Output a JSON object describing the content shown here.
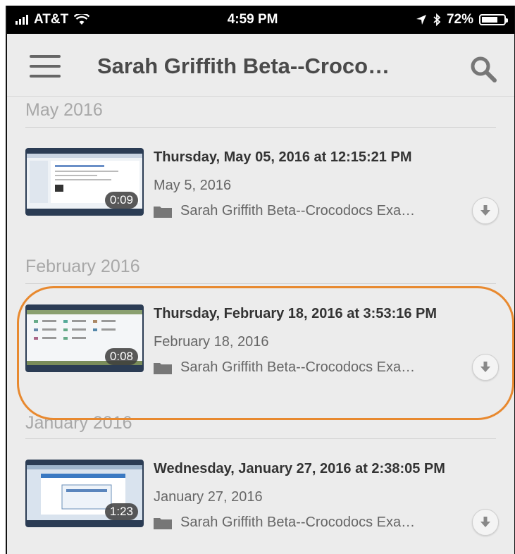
{
  "status_bar": {
    "carrier": "AT&T",
    "time": "4:59 PM",
    "battery": "72%",
    "battery_level": 0.72
  },
  "nav": {
    "title": "Sarah Griffith Beta--Croco…",
    "menu_icon": "hamburger-menu-icon",
    "search_icon": "search-icon"
  },
  "sections": [
    {
      "header": "May 2016",
      "items": [
        {
          "title": "Thursday, May 05, 2016 at 12:15:21 PM",
          "date": "May 5, 2016",
          "folder": "Sarah Griffith Beta--Crocodocs Exa…",
          "duration": "0:09"
        }
      ]
    },
    {
      "header": "February 2016",
      "items": [
        {
          "title": "Thursday, February 18, 2016 at 3:53:16 PM",
          "date": "February 18, 2016",
          "folder": "Sarah Griffith Beta--Crocodocs Exa…",
          "duration": "0:08"
        }
      ]
    },
    {
      "header": "January 2016",
      "items": [
        {
          "title": "Wednesday, January 27, 2016 at 2:38:05 PM",
          "date": "January 27, 2016",
          "folder": "Sarah Griffith Beta--Crocodocs Exa…",
          "duration": "1:23"
        }
      ]
    }
  ],
  "colors": {
    "highlight": "#e8892f",
    "background": "#ececec"
  }
}
